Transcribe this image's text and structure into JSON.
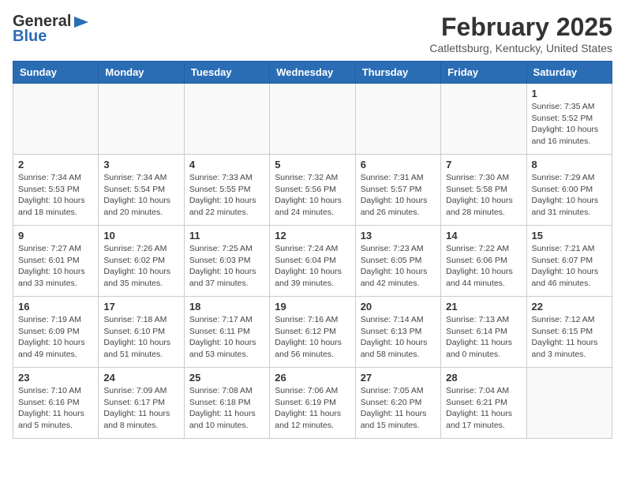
{
  "header": {
    "logo_general": "General",
    "logo_blue": "Blue",
    "month_title": "February 2025",
    "location": "Catlettsburg, Kentucky, United States"
  },
  "calendar": {
    "weekdays": [
      "Sunday",
      "Monday",
      "Tuesday",
      "Wednesday",
      "Thursday",
      "Friday",
      "Saturday"
    ],
    "weeks": [
      [
        {
          "day": "",
          "info": ""
        },
        {
          "day": "",
          "info": ""
        },
        {
          "day": "",
          "info": ""
        },
        {
          "day": "",
          "info": ""
        },
        {
          "day": "",
          "info": ""
        },
        {
          "day": "",
          "info": ""
        },
        {
          "day": "1",
          "info": "Sunrise: 7:35 AM\nSunset: 5:52 PM\nDaylight: 10 hours and 16 minutes."
        }
      ],
      [
        {
          "day": "2",
          "info": "Sunrise: 7:34 AM\nSunset: 5:53 PM\nDaylight: 10 hours and 18 minutes."
        },
        {
          "day": "3",
          "info": "Sunrise: 7:34 AM\nSunset: 5:54 PM\nDaylight: 10 hours and 20 minutes."
        },
        {
          "day": "4",
          "info": "Sunrise: 7:33 AM\nSunset: 5:55 PM\nDaylight: 10 hours and 22 minutes."
        },
        {
          "day": "5",
          "info": "Sunrise: 7:32 AM\nSunset: 5:56 PM\nDaylight: 10 hours and 24 minutes."
        },
        {
          "day": "6",
          "info": "Sunrise: 7:31 AM\nSunset: 5:57 PM\nDaylight: 10 hours and 26 minutes."
        },
        {
          "day": "7",
          "info": "Sunrise: 7:30 AM\nSunset: 5:58 PM\nDaylight: 10 hours and 28 minutes."
        },
        {
          "day": "8",
          "info": "Sunrise: 7:29 AM\nSunset: 6:00 PM\nDaylight: 10 hours and 31 minutes."
        }
      ],
      [
        {
          "day": "9",
          "info": "Sunrise: 7:27 AM\nSunset: 6:01 PM\nDaylight: 10 hours and 33 minutes."
        },
        {
          "day": "10",
          "info": "Sunrise: 7:26 AM\nSunset: 6:02 PM\nDaylight: 10 hours and 35 minutes."
        },
        {
          "day": "11",
          "info": "Sunrise: 7:25 AM\nSunset: 6:03 PM\nDaylight: 10 hours and 37 minutes."
        },
        {
          "day": "12",
          "info": "Sunrise: 7:24 AM\nSunset: 6:04 PM\nDaylight: 10 hours and 39 minutes."
        },
        {
          "day": "13",
          "info": "Sunrise: 7:23 AM\nSunset: 6:05 PM\nDaylight: 10 hours and 42 minutes."
        },
        {
          "day": "14",
          "info": "Sunrise: 7:22 AM\nSunset: 6:06 PM\nDaylight: 10 hours and 44 minutes."
        },
        {
          "day": "15",
          "info": "Sunrise: 7:21 AM\nSunset: 6:07 PM\nDaylight: 10 hours and 46 minutes."
        }
      ],
      [
        {
          "day": "16",
          "info": "Sunrise: 7:19 AM\nSunset: 6:09 PM\nDaylight: 10 hours and 49 minutes."
        },
        {
          "day": "17",
          "info": "Sunrise: 7:18 AM\nSunset: 6:10 PM\nDaylight: 10 hours and 51 minutes."
        },
        {
          "day": "18",
          "info": "Sunrise: 7:17 AM\nSunset: 6:11 PM\nDaylight: 10 hours and 53 minutes."
        },
        {
          "day": "19",
          "info": "Sunrise: 7:16 AM\nSunset: 6:12 PM\nDaylight: 10 hours and 56 minutes."
        },
        {
          "day": "20",
          "info": "Sunrise: 7:14 AM\nSunset: 6:13 PM\nDaylight: 10 hours and 58 minutes."
        },
        {
          "day": "21",
          "info": "Sunrise: 7:13 AM\nSunset: 6:14 PM\nDaylight: 11 hours and 0 minutes."
        },
        {
          "day": "22",
          "info": "Sunrise: 7:12 AM\nSunset: 6:15 PM\nDaylight: 11 hours and 3 minutes."
        }
      ],
      [
        {
          "day": "23",
          "info": "Sunrise: 7:10 AM\nSunset: 6:16 PM\nDaylight: 11 hours and 5 minutes."
        },
        {
          "day": "24",
          "info": "Sunrise: 7:09 AM\nSunset: 6:17 PM\nDaylight: 11 hours and 8 minutes."
        },
        {
          "day": "25",
          "info": "Sunrise: 7:08 AM\nSunset: 6:18 PM\nDaylight: 11 hours and 10 minutes."
        },
        {
          "day": "26",
          "info": "Sunrise: 7:06 AM\nSunset: 6:19 PM\nDaylight: 11 hours and 12 minutes."
        },
        {
          "day": "27",
          "info": "Sunrise: 7:05 AM\nSunset: 6:20 PM\nDaylight: 11 hours and 15 minutes."
        },
        {
          "day": "28",
          "info": "Sunrise: 7:04 AM\nSunset: 6:21 PM\nDaylight: 11 hours and 17 minutes."
        },
        {
          "day": "",
          "info": ""
        }
      ]
    ]
  }
}
